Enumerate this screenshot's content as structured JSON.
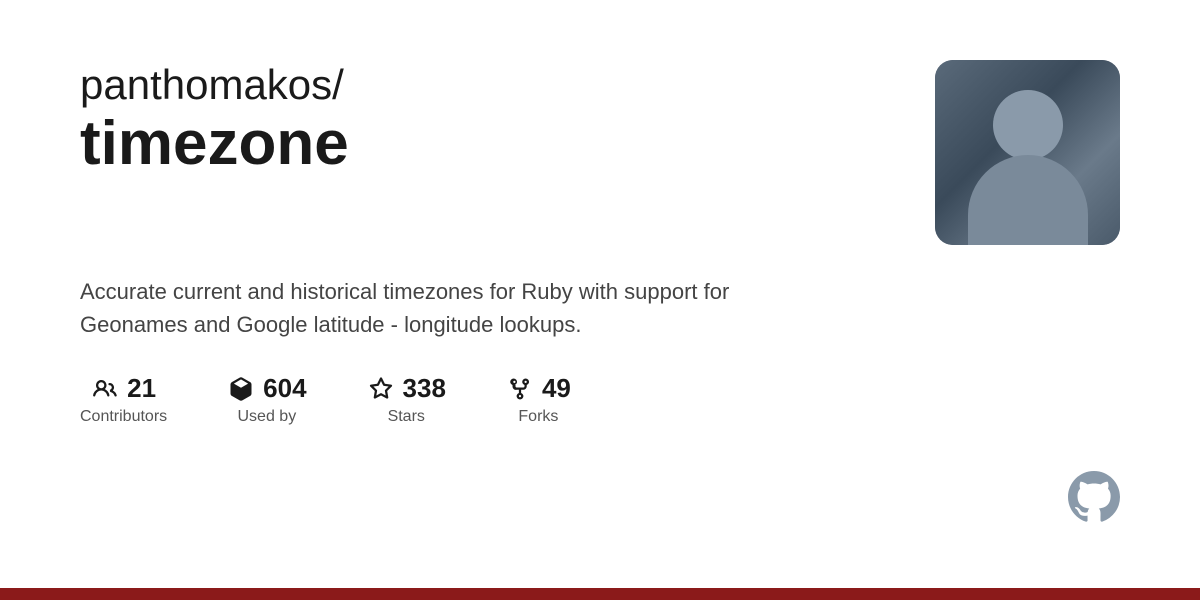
{
  "repo": {
    "owner": "panthomakos/",
    "name": "timezone",
    "description": "Accurate current and historical timezones for Ruby with support for Geonames and Google latitude - longitude lookups."
  },
  "stats": [
    {
      "id": "contributors",
      "number": "21",
      "label": "Contributors"
    },
    {
      "id": "used-by",
      "number": "604",
      "label": "Used by"
    },
    {
      "id": "stars",
      "number": "338",
      "label": "Stars"
    },
    {
      "id": "forks",
      "number": "49",
      "label": "Forks"
    }
  ],
  "bottom_bar_color": "#8b1a1a"
}
